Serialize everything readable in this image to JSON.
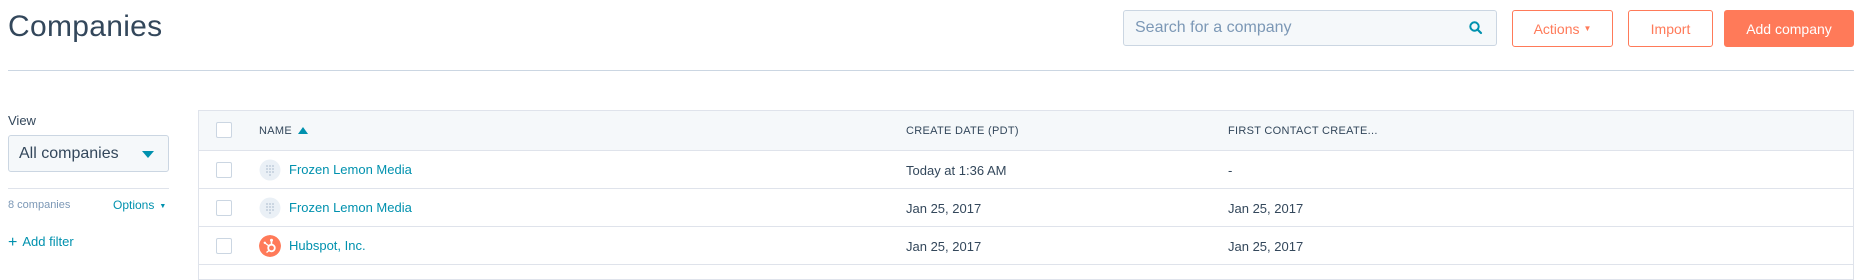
{
  "header": {
    "title": "Companies",
    "search_placeholder": "Search for a company",
    "actions_label": "Actions",
    "import_label": "Import",
    "add_label": "Add company"
  },
  "sidebar": {
    "view_label": "View",
    "view_selected": "All companies",
    "count_text": "8 companies",
    "options_label": "Options",
    "add_filter_label": "Add filter"
  },
  "table": {
    "columns": [
      "NAME",
      "CREATE DATE (PDT)",
      "FIRST CONTACT CREATE..."
    ],
    "rows": [
      {
        "name": "Frozen Lemon Media",
        "logo": "placeholder-logo-icon",
        "create_date": "Today at 1:36 AM",
        "first_contact": "-"
      },
      {
        "name": "Frozen Lemon Media",
        "logo": "placeholder-logo-icon",
        "create_date": "Jan 25, 2017",
        "first_contact": "Jan 25, 2017"
      },
      {
        "name": "Hubspot, Inc.",
        "logo": "hubspot-logo-icon",
        "create_date": "Jan 25, 2017",
        "first_contact": "Jan 25, 2017"
      }
    ]
  },
  "colors": {
    "accent": "#ff7a59",
    "link": "#0091ae",
    "text": "#33475b",
    "border": "#cbd6e2"
  }
}
